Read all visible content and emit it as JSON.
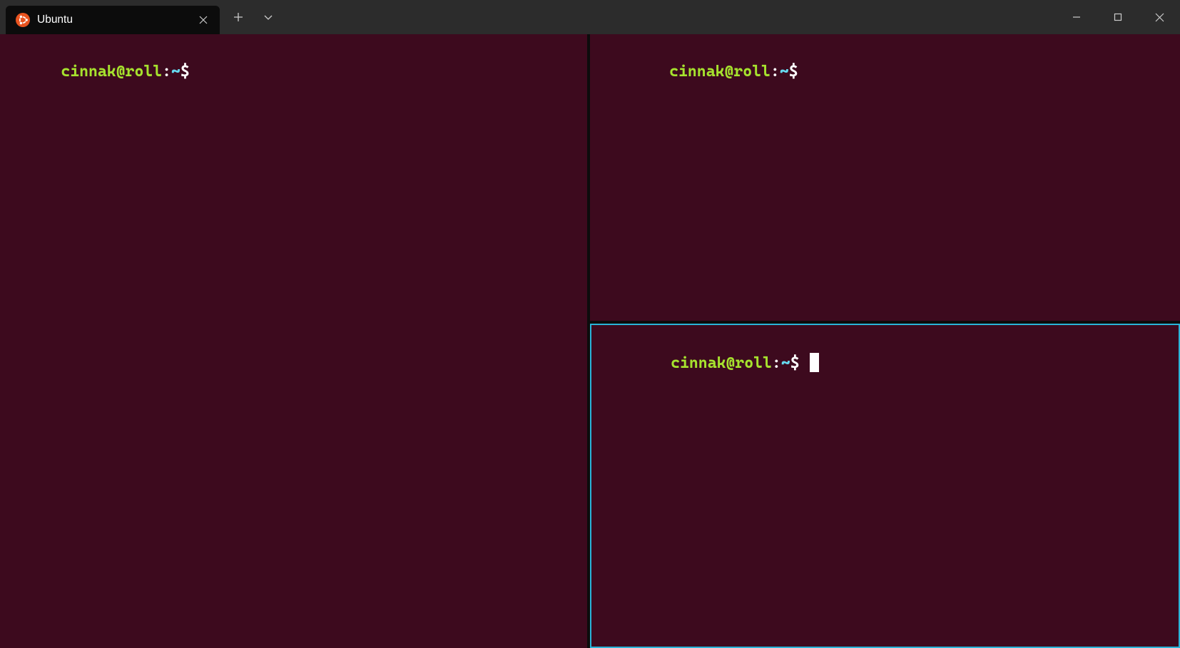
{
  "titlebar": {
    "tab": {
      "label": "Ubuntu",
      "icon": "ubuntu-icon"
    }
  },
  "panes": {
    "left": {
      "user_host": "cinnak@roll",
      "colon": ":",
      "path": "~",
      "dollar": "$",
      "space": " "
    },
    "top_right": {
      "user_host": "cinnak@roll",
      "colon": ":",
      "path": "~",
      "dollar": "$",
      "space": " "
    },
    "bottom_right": {
      "user_host": "cinnak@roll",
      "colon": ":",
      "path": "~",
      "dollar": "$",
      "space": " ",
      "cursor": true
    }
  },
  "colors": {
    "terminal_bg": "#3d0a1e",
    "user_host": "#a6e22e",
    "path": "#66d9ef",
    "text": "#ffffff",
    "active_border": "#29b4d8",
    "titlebar": "#2c2c2c",
    "tab_active": "#0c0c0c"
  }
}
